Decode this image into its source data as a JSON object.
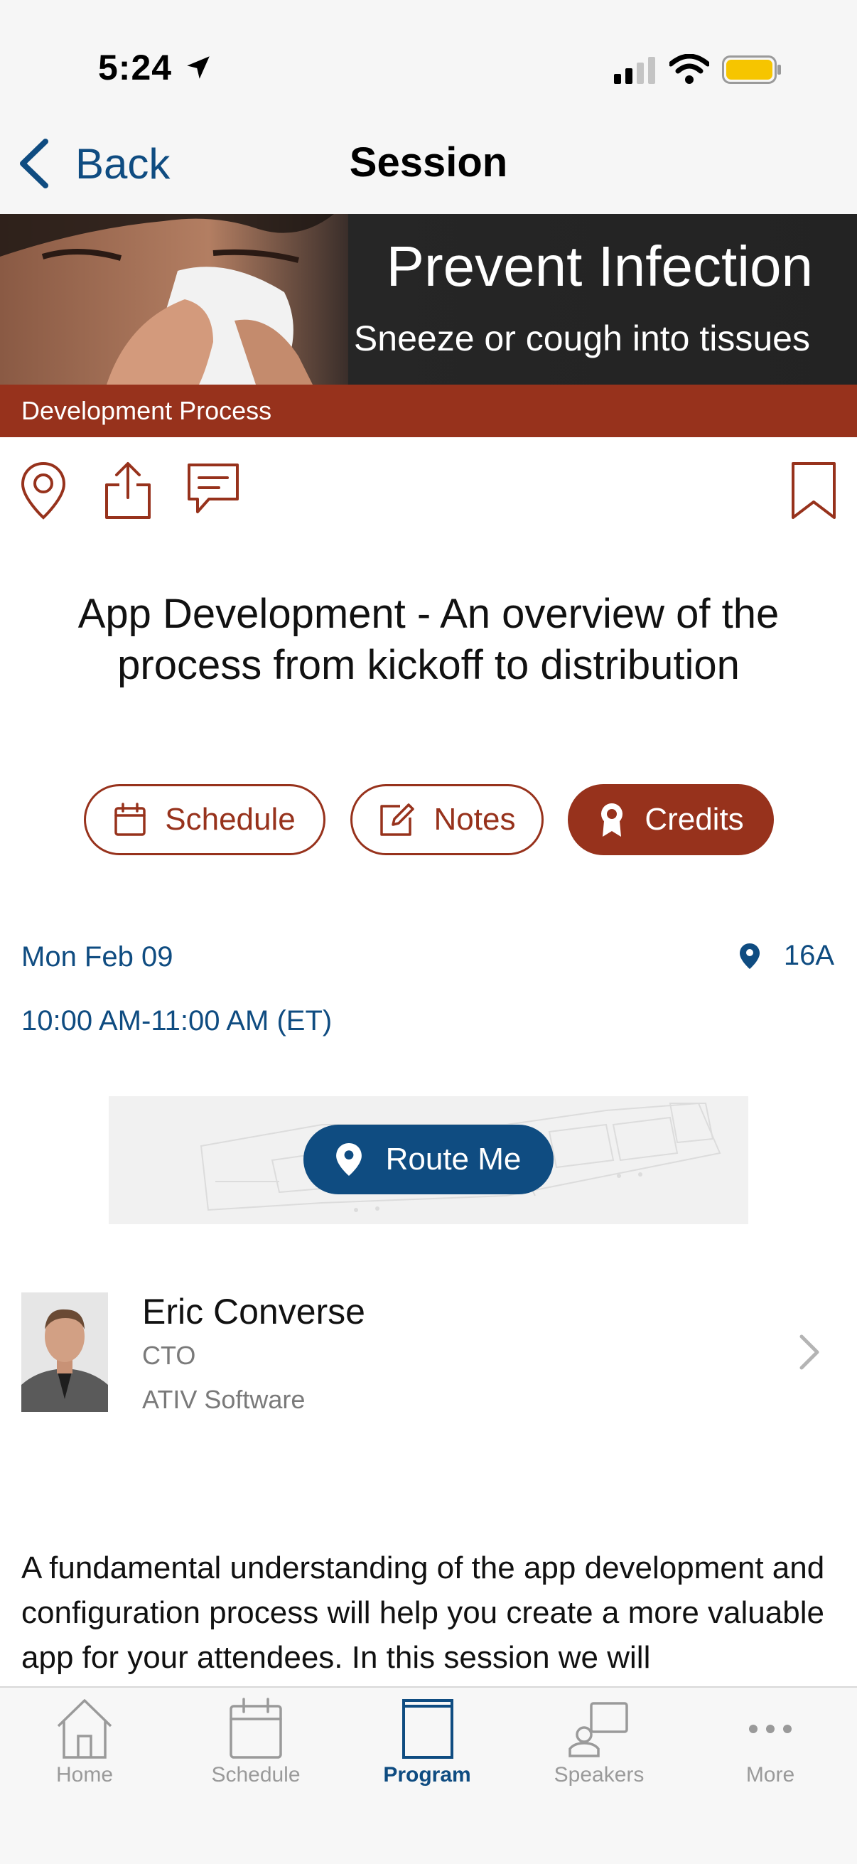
{
  "status": {
    "time": "5:24"
  },
  "nav": {
    "back_label": "Back",
    "title": "Session"
  },
  "banner": {
    "title": "Prevent Infection",
    "subtitle": "Sneeze or cough into tissues"
  },
  "track": "Development Process",
  "session": {
    "title": "App Development - An overview of the process from kickoff to distribution"
  },
  "actions": {
    "schedule": "Schedule",
    "notes": "Notes",
    "credits": "Credits"
  },
  "details": {
    "date": "Mon Feb 09",
    "time": "10:00 AM-11:00 AM (ET)",
    "room": "16A"
  },
  "map": {
    "route_label": "Route Me"
  },
  "speaker": {
    "name": "Eric Converse",
    "title": "CTO",
    "organization": "ATIV Software"
  },
  "description": "A fundamental understanding of the app development and configuration process will help you create a more valuable app for your attendees. In this session we will",
  "tabs": [
    {
      "label": "Home",
      "icon": "home-icon"
    },
    {
      "label": "Schedule",
      "icon": "calendar-icon"
    },
    {
      "label": "Program",
      "icon": "book-icon"
    },
    {
      "label": "Speakers",
      "icon": "speaker-icon"
    },
    {
      "label": "More",
      "icon": "more-icon"
    }
  ],
  "colors": {
    "accent": "#97321c",
    "primary": "#0f4c81",
    "tab_inactive": "#9a9a9a"
  }
}
